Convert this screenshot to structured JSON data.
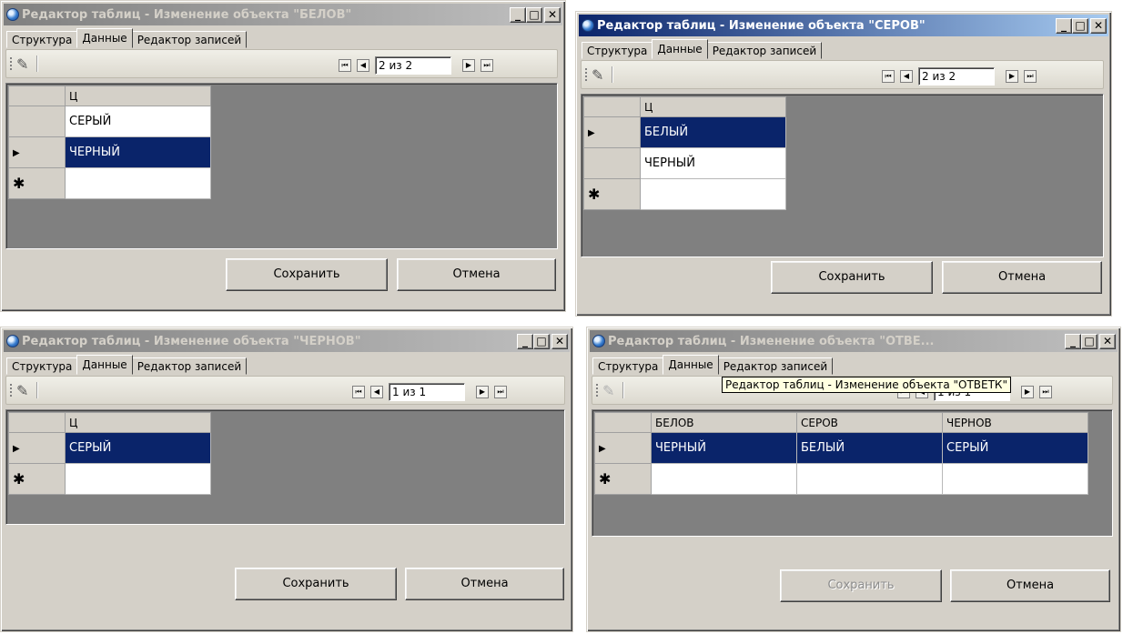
{
  "windows": [
    {
      "title": "Редактор таблиц  -  Изменение объекта \"БЕЛОВ\"",
      "tabs": [
        "Структура",
        "Данные",
        "Редактор записей"
      ],
      "position_text": "2 из 2",
      "header": [
        "Ц"
      ],
      "rows": [
        [
          "СЕРЫЙ"
        ],
        [
          "ЧЕРНЫЙ"
        ],
        [
          ""
        ]
      ],
      "save": "Сохранить",
      "cancel": "Отмена"
    },
    {
      "title": "Редактор таблиц  -  Изменение объекта \"СЕРОВ\"",
      "tabs": [
        "Структура",
        "Данные",
        "Редактор записей"
      ],
      "position_text": "2 из 2",
      "header": [
        "Ц"
      ],
      "rows": [
        [
          "БЕЛЫЙ"
        ],
        [
          "ЧЕРНЫЙ"
        ],
        [
          ""
        ]
      ],
      "save": "Сохранить",
      "cancel": "Отмена"
    },
    {
      "title": "Редактор таблиц  -  Изменение объекта \"ЧЕРНОВ\"",
      "tabs": [
        "Структура",
        "Данные",
        "Редактор записей"
      ],
      "position_text": "1 из 1",
      "header": [
        "Ц"
      ],
      "rows": [
        [
          "СЕРЫЙ"
        ],
        [
          ""
        ]
      ],
      "save": "Сохранить",
      "cancel": "Отмена"
    },
    {
      "title": "Редактор таблиц  -  Изменение объекта \"ОТВЕ...",
      "tabs": [
        "Структура",
        "Данные",
        "Редактор записей"
      ],
      "position_text": "1 из 1",
      "header": [
        "БЕЛОВ",
        "СЕРОВ",
        "ЧЕРНОВ"
      ],
      "rows": [
        [
          "ЧЕРНЫЙ",
          "БЕЛЫЙ",
          "СЕРЫЙ"
        ],
        [
          "",
          "",
          ""
        ]
      ],
      "save": "Сохранить",
      "cancel": "Отмена",
      "tooltip": "Редактор таблиц  -  Изменение объекта \"ОТВЕТК\""
    }
  ],
  "icons": {
    "minimize": "_",
    "maximize": "□",
    "close": "✕",
    "nav_first": "⏮",
    "nav_prev": "◀",
    "nav_next": "▶",
    "nav_last": "⏭",
    "row_current": "▶",
    "row_new": "✱",
    "toolbar_tool": "✎"
  }
}
